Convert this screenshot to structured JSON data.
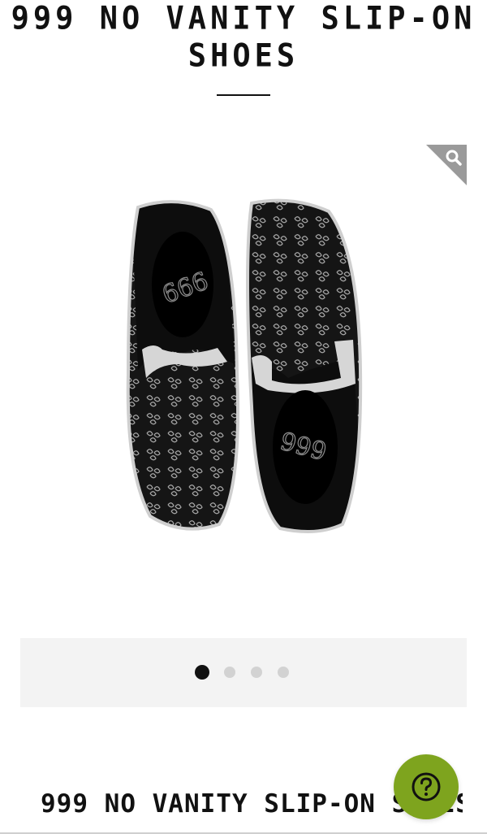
{
  "product": {
    "title_line1": "999 NO VANITY SLIP-ON",
    "title_line2": "SHOES",
    "title_full": "999 NO VANITY SLIP-ON SHOES"
  },
  "gallery": {
    "slide_count": 4,
    "active_index": 0,
    "zoom_icon": "magnifier-icon"
  },
  "help": {
    "icon": "question-mark-icon",
    "color": "#7ea41e"
  },
  "colors": {
    "shoe_body": "#111111",
    "shoe_trim": "#d8d8d8",
    "dots_bar": "#f3f3f3",
    "dot_active": "#111111",
    "dot_inactive": "#d2d2d2"
  }
}
